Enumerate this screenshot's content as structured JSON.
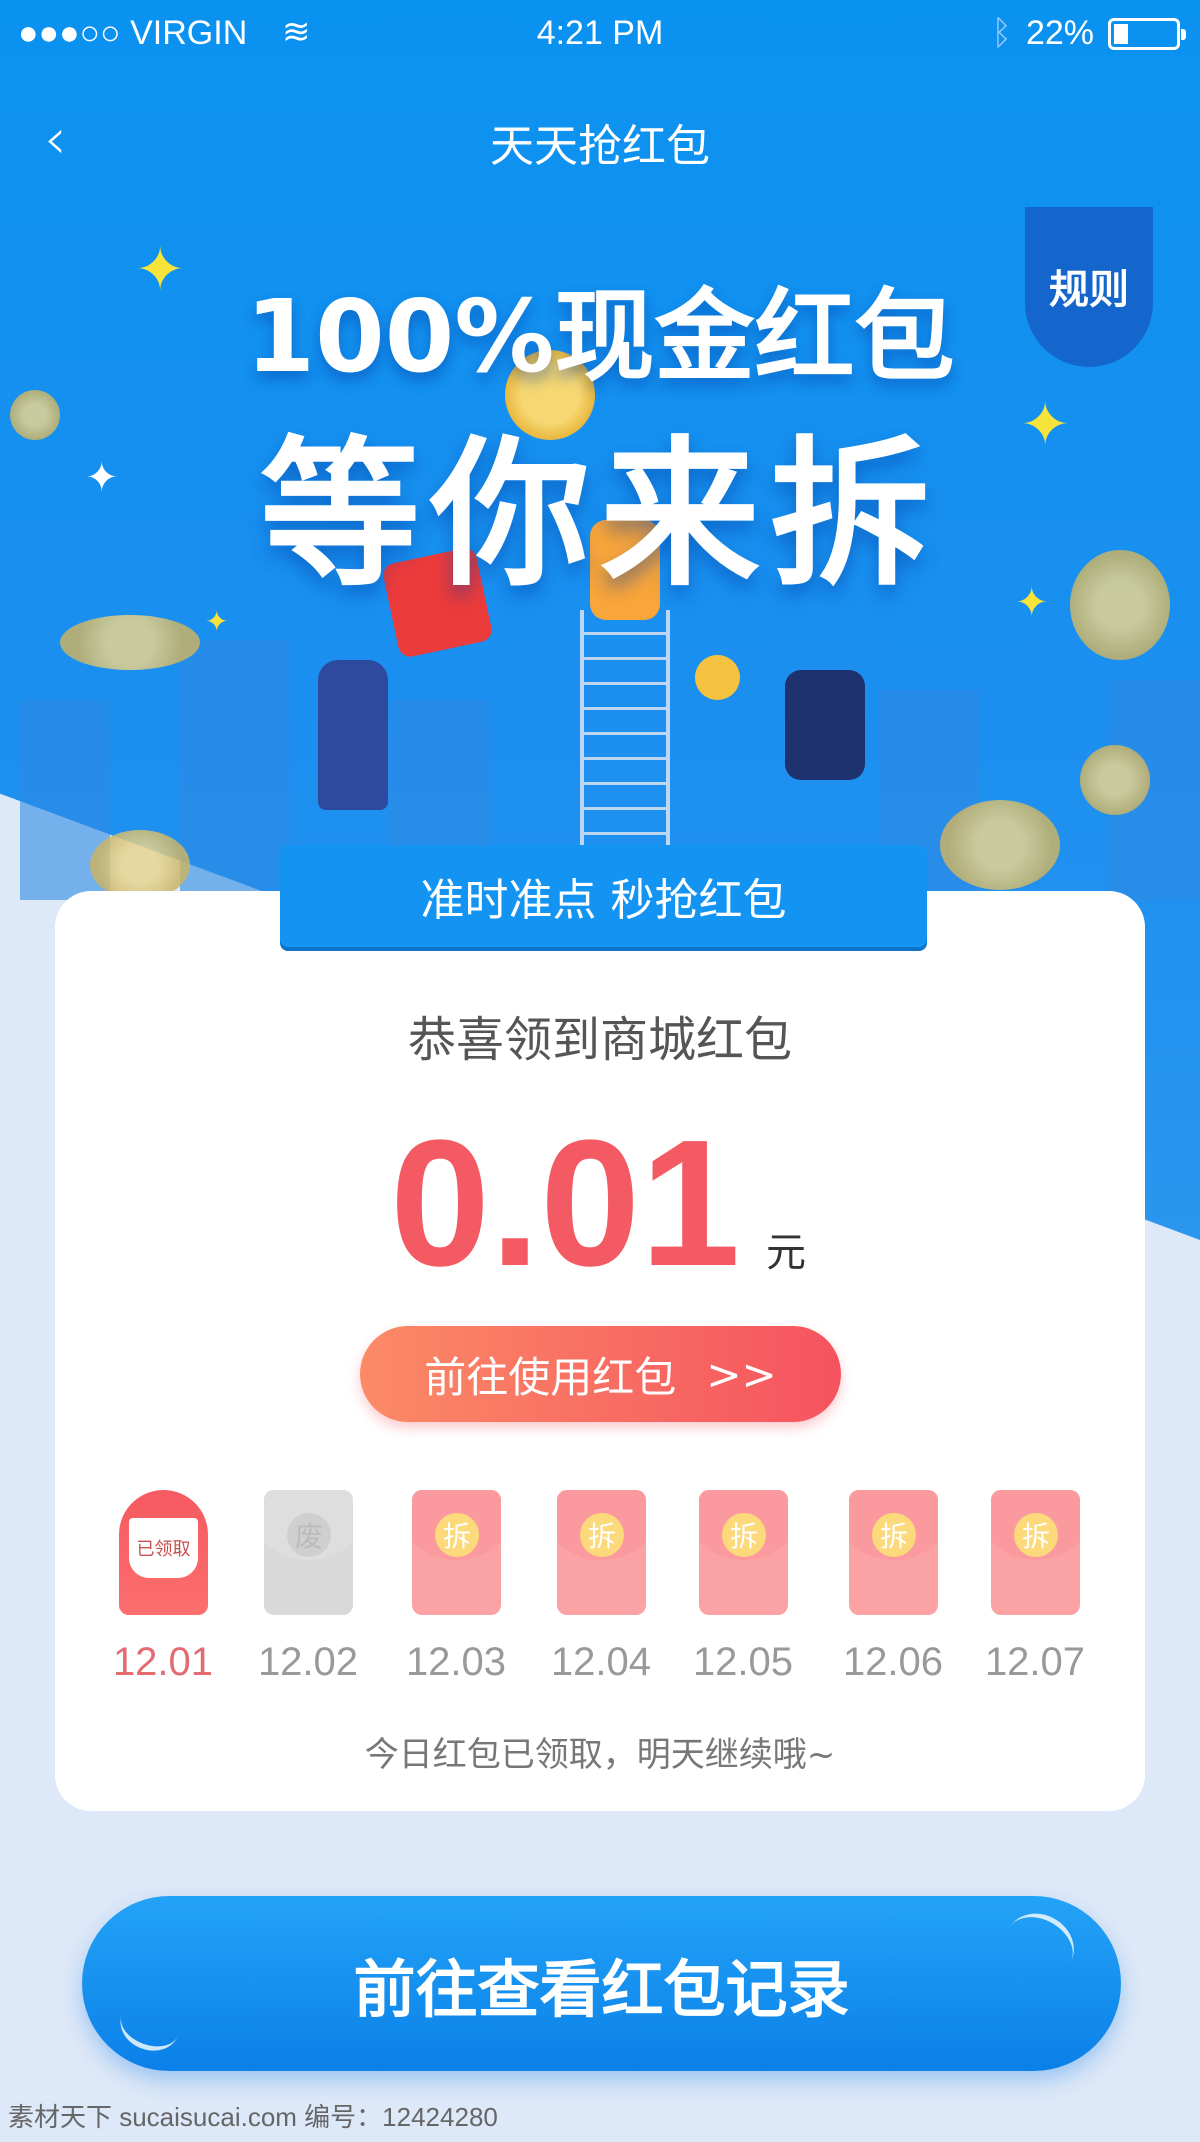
{
  "status_bar": {
    "carrier": "●●●○○ VIRGIN",
    "time": "4:21 PM",
    "battery": "22%",
    "battery_level": 0.22
  },
  "nav": {
    "title": "天天抢红包",
    "back_icon": "chevron-left-icon"
  },
  "banner": {
    "headline": "100%现金红包",
    "subheadline": "等你来拆",
    "rules_label": "规则"
  },
  "card": {
    "tab_label": "准时准点 秒抢红包",
    "congrats": "恭喜领到商城红包",
    "amount": "0.01",
    "unit": "元",
    "use_button": "前往使用红包",
    "use_button_icon": ">>",
    "envelopes": [
      {
        "date": "12.01",
        "state": "received",
        "label": "已领取"
      },
      {
        "date": "12.02",
        "state": "expired",
        "label": "废"
      },
      {
        "date": "12.03",
        "state": "open",
        "label": "拆"
      },
      {
        "date": "12.04",
        "state": "open",
        "label": "拆"
      },
      {
        "date": "12.05",
        "state": "open",
        "label": "拆"
      },
      {
        "date": "12.06",
        "state": "open",
        "label": "拆"
      },
      {
        "date": "12.07",
        "state": "open",
        "label": "拆"
      }
    ],
    "tip": "今日红包已领取，明天继续哦~"
  },
  "records_button": "前往查看红包记录",
  "watermark": "素材天下 sucaisucai.com  编号：12424280",
  "colors": {
    "primary_blue": "#0a92f0",
    "red": "#f45a63",
    "background": "#dde8f8"
  }
}
